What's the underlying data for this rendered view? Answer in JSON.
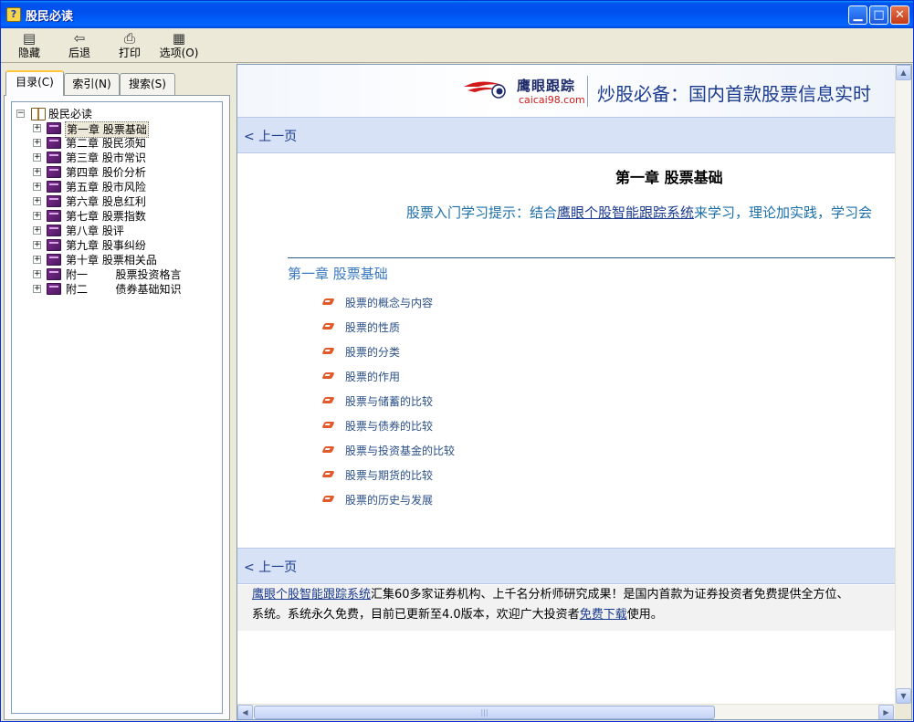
{
  "window": {
    "title": "股民必读",
    "icon": "help-file-icon"
  },
  "toolbar": {
    "buttons": [
      {
        "label": "隐藏",
        "icon": "hide-pane-icon"
      },
      {
        "label": "后退",
        "icon": "back-arrow-icon"
      },
      {
        "label": "打印",
        "icon": "printer-icon"
      },
      {
        "label": "选项(O)",
        "icon": "options-icon"
      }
    ]
  },
  "tabs": [
    {
      "label": "目录(C)",
      "active": true
    },
    {
      "label": "索引(N)",
      "active": false
    },
    {
      "label": "搜索(S)",
      "active": false
    }
  ],
  "tree": {
    "root": "股民必读",
    "items": [
      {
        "label": "第一章  股票基础",
        "selected": true
      },
      {
        "label": "第二章  股民须知"
      },
      {
        "label": "第三章  股市常识"
      },
      {
        "label": "第四章  股价分析"
      },
      {
        "label": "第五章  股市风险"
      },
      {
        "label": "第六章  股息红利"
      },
      {
        "label": "第七章  股票指数"
      },
      {
        "label": "第八章  股评"
      },
      {
        "label": "第九章  股事纠纷"
      },
      {
        "label": "第十章  股票相关品"
      },
      {
        "label": "附一        股票投资格言"
      },
      {
        "label": "附二        债券基础知识"
      }
    ]
  },
  "content": {
    "banner": {
      "logo_cn": "鹰眼跟踪",
      "logo_en": "caicai98.com",
      "slogan": "炒股必备：国内首款股票信息实时"
    },
    "prev_link": "< 上一页",
    "chapter_title": "第一章  股票基础",
    "tip_prefix": "股票入门学习提示：结合",
    "tip_link": "鹰眼个股智能跟踪系统",
    "tip_suffix": "来学习，理论加实践，学习会",
    "toc_heading": "第一章  股票基础",
    "toc_items": [
      "股票的概念与内容",
      "股票的性质",
      "股票的分类",
      "股票的作用",
      "股票与储蓄的比较",
      "股票与债券的比较",
      "股票与投资基金的比较",
      "股票与期货的比较",
      "股票的历史与发展"
    ],
    "footer": {
      "link1": "鹰眼个股智能跟踪系统",
      "text1": "汇集60多家证券机构、上千名分析师研究成果！是国内首款为证券投资者免费提供全方位、",
      "text2": "系统。系统永久免费，目前已更新至4.0版本，欢迎广大投资者",
      "link2": "免费下载",
      "text3": "使用。"
    }
  },
  "colors": {
    "titlebar": "#0054e3",
    "nav_band": "#d7e2f6",
    "link": "#1a3a8f",
    "tip_text": "#1b6fa8",
    "bullet": "#e25a2a"
  }
}
